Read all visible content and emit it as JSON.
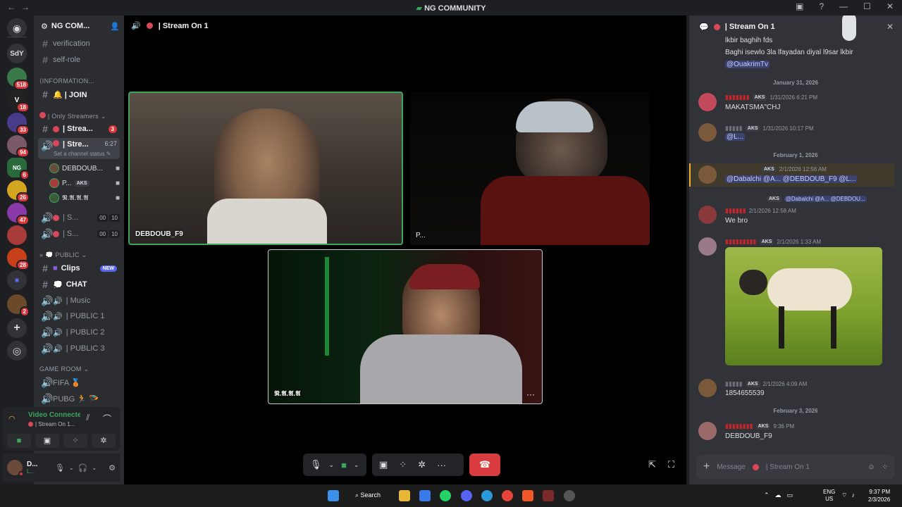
{
  "window": {
    "title": "NG COMMUNITY",
    "nav_back": "←",
    "nav_forward": "→",
    "controls": [
      "▣",
      "?",
      "—",
      "☐",
      "✕"
    ]
  },
  "server_list": {
    "items": [
      {
        "label": "",
        "icon": "discord-logo-icon"
      },
      {
        "label": "SdY"
      },
      {
        "label": "",
        "badge": "518"
      },
      {
        "label": "",
        "badge": "18"
      },
      {
        "label": "",
        "badge": "33"
      },
      {
        "label": "",
        "badge": "94"
      },
      {
        "label": "",
        "badge": "6"
      },
      {
        "label": "",
        "badge": "26"
      },
      {
        "label": "",
        "badge": "47"
      },
      {
        "label": "",
        "badge": "28"
      },
      {
        "label": "",
        "badge": "2"
      }
    ],
    "add": "+",
    "discover": "◎"
  },
  "server": {
    "name": "NG COM...",
    "channels_top": [
      {
        "name": "verification"
      },
      {
        "name": "self-role"
      }
    ],
    "cat_info": "⟨INFORMATION...",
    "join": "🔔 | JOIN",
    "cat_streamers": "| Only Streamers ⌄",
    "stream_text_channel": "| Strea...",
    "stream_text_badge": "3",
    "active_voice": "| Stre...",
    "active_voice_time": "6:27",
    "set_status": "Set a channel status",
    "voice_users": [
      {
        "name": "DEBDOUB..."
      },
      {
        "name": "P...",
        "tag": "AKS"
      },
      {
        "name": "𝕹.𝕬.𝕬.𝕬"
      }
    ],
    "voice_small": [
      {
        "name": "| S...",
        "a": "00",
        "b": "10"
      },
      {
        "name": "| S...",
        "a": "00",
        "b": "10"
      }
    ],
    "cat_public": "» 💭 PUBLIC ⌄",
    "public_channels": [
      {
        "name": "Clips",
        "badge": "NEW"
      },
      {
        "name": "CHAT"
      },
      {
        "name": "| Music"
      },
      {
        "name": "| PUBLIC 1"
      },
      {
        "name": "| PUBLIC 2"
      },
      {
        "name": "| PUBLIC 3"
      }
    ],
    "cat_game": "GAME ROOM ⌄",
    "game_channels": [
      {
        "name": "FIFA 🥉"
      },
      {
        "name": "PUBG 🏃 🪂"
      }
    ]
  },
  "voice_connection": {
    "status": "Video Connecte...",
    "channel": "| Stream On 1..."
  },
  "user_panel": {
    "name": "D...",
    "sub": "L..."
  },
  "call": {
    "channel_title": "| Stream On 1",
    "participants": [
      {
        "name": "DEBDOUB_F9"
      },
      {
        "name": "P..."
      },
      {
        "name": "𝕹.𝕬.𝕬.𝕬"
      }
    ],
    "more": "···"
  },
  "chat": {
    "header": "| Stream On 1",
    "lines_top": [
      "lkbir baghih fds",
      "Baghi isewlo 3la lfayadan diyal l9sar lkbir"
    ],
    "mention_top": "@OuakrimTv",
    "dates": [
      "January 31, 2026",
      "February 1, 2026",
      "February 3, 2026"
    ],
    "messages": [
      {
        "user": "▮▮▮▮▮▮▮",
        "tag": "AKS",
        "time": "1/31/2026 6:21 PM",
        "text": "MAKATSMA\"CHJ"
      },
      {
        "user": "▮▮▮▮▮",
        "tag": "AKS",
        "time": "1/31/2026 10:17 PM",
        "text": "@L..."
      },
      {
        "user": "",
        "tag": "AKS",
        "time": "2/1/2026 12:56 AM",
        "text": "@Dabalchi @A... @DEBDOUB_F9 @L..."
      },
      {
        "user": "▮▮▮▮▮▮",
        "tag": "AKS",
        "time": "2/1/2026 12:58 AM",
        "text": "We bro",
        "reply": "@Dabalchi @A... @DEBDOU..."
      },
      {
        "user": "▮▮▮▮▮▮▮▮▮",
        "tag": "AKS",
        "time": "2/1/2026 1:33 AM",
        "text": ""
      },
      {
        "user": "▮▮▮▮▮",
        "tag": "AKS",
        "time": "2/1/2026 4:09 AM",
        "text": "1854655539"
      },
      {
        "user": "▮▮▮▮▮▮▮▮",
        "tag": "AKS",
        "time": "9:36 PM",
        "text": "DEBDOUB_F9"
      }
    ],
    "composer_placeholder": "Message",
    "composer_channel": "| Stream On 1"
  },
  "taskbar": {
    "search": "Search",
    "lang": "ENG",
    "region": "US",
    "time": "9:37 PM",
    "date": "2/3/2026"
  },
  "colors": {
    "accent": "#5865f2",
    "danger": "#da373c",
    "speaking": "#3ba55d",
    "hangup": "#d83c3e"
  }
}
